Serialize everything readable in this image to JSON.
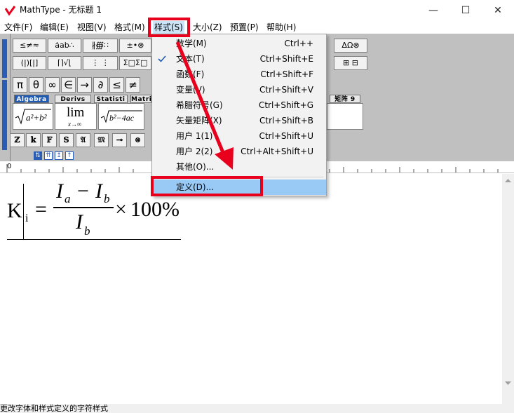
{
  "window": {
    "title": "MathType - 无标题 1",
    "controls": {
      "minimize": "—",
      "maximize": "☐",
      "close": "✕"
    }
  },
  "menubar": {
    "items": [
      {
        "label": "文件(F)"
      },
      {
        "label": "编辑(E)"
      },
      {
        "label": "视图(V)"
      },
      {
        "label": "格式(M)"
      },
      {
        "label": "样式(S)"
      },
      {
        "label": "大小(Z)"
      },
      {
        "label": "预置(P)"
      },
      {
        "label": "帮助(H)"
      }
    ]
  },
  "style_menu": {
    "items": [
      {
        "label": "数学(M)",
        "shortcut": "Ctrl++",
        "checked": false
      },
      {
        "label": "文本(T)",
        "shortcut": "Ctrl+Shift+E",
        "checked": true
      },
      {
        "label": "函数(F)",
        "shortcut": "Ctrl+Shift+F",
        "checked": false
      },
      {
        "label": "变量(V)",
        "shortcut": "Ctrl+Shift+V",
        "checked": false
      },
      {
        "label": "希腊符号(G)",
        "shortcut": "Ctrl+Shift+G",
        "checked": false
      },
      {
        "label": "矢量矩阵(X)",
        "shortcut": "Ctrl+Shift+B",
        "checked": false
      },
      {
        "label": "用户 1(1)",
        "shortcut": "Ctrl+Shift+U",
        "checked": false
      },
      {
        "label": "用户 2(2)",
        "shortcut": "Ctrl+Alt+Shift+U",
        "checked": false
      },
      {
        "label": "其他(O)...",
        "shortcut": "",
        "checked": false
      },
      {
        "label": "定义(D)...",
        "shortcut": "",
        "highlighted": true
      }
    ]
  },
  "toolbar": {
    "row1": [
      "≤≠≈",
      "ȧab∴",
      "∦∰∷",
      "±•⊗"
    ],
    "row2": [
      "(|)[|]",
      "⌈⌉√⌊",
      "⋮ ⋮",
      "Σ□Σ□"
    ],
    "row1_right": "ΔΩ⊗",
    "row2_right": "⊞ ⊟",
    "row3": [
      "π",
      "θ",
      "∞",
      "∈",
      "→",
      "∂",
      "≤",
      "≠"
    ],
    "tabs": [
      "Algebra",
      "Derivs",
      "Statisti",
      "Matri",
      "矩阵 9"
    ],
    "templates": {
      "lim_top": "lim",
      "lim_bottom": "x→∞"
    },
    "symbols": [
      "ℤ",
      "𝕜",
      "𝔽",
      "𝕊",
      "𝔄",
      "𝔐",
      "⊸",
      "⊗"
    ],
    "nav": [
      "⇅",
      "⇈",
      "↥",
      "↑"
    ]
  },
  "ruler": {
    "zero": "0"
  },
  "formula": {
    "lhs_main": "K",
    "lhs_sub": "i",
    "equals": "=",
    "num_a": "I",
    "num_a_sub": "a",
    "minus": "−",
    "num_b": "I",
    "num_b_sub": "b",
    "den": "I",
    "den_sub": "b",
    "times": "×",
    "percent": "100%"
  },
  "status": {
    "text": "更改字体和样式定义的字符样式"
  },
  "colors": {
    "accent": "#2a5db5",
    "highlight": "#99c9f5",
    "annotation": "#e8001c"
  },
  "icons": {
    "checkmark": "check-icon",
    "logo": "mathtype-logo"
  }
}
